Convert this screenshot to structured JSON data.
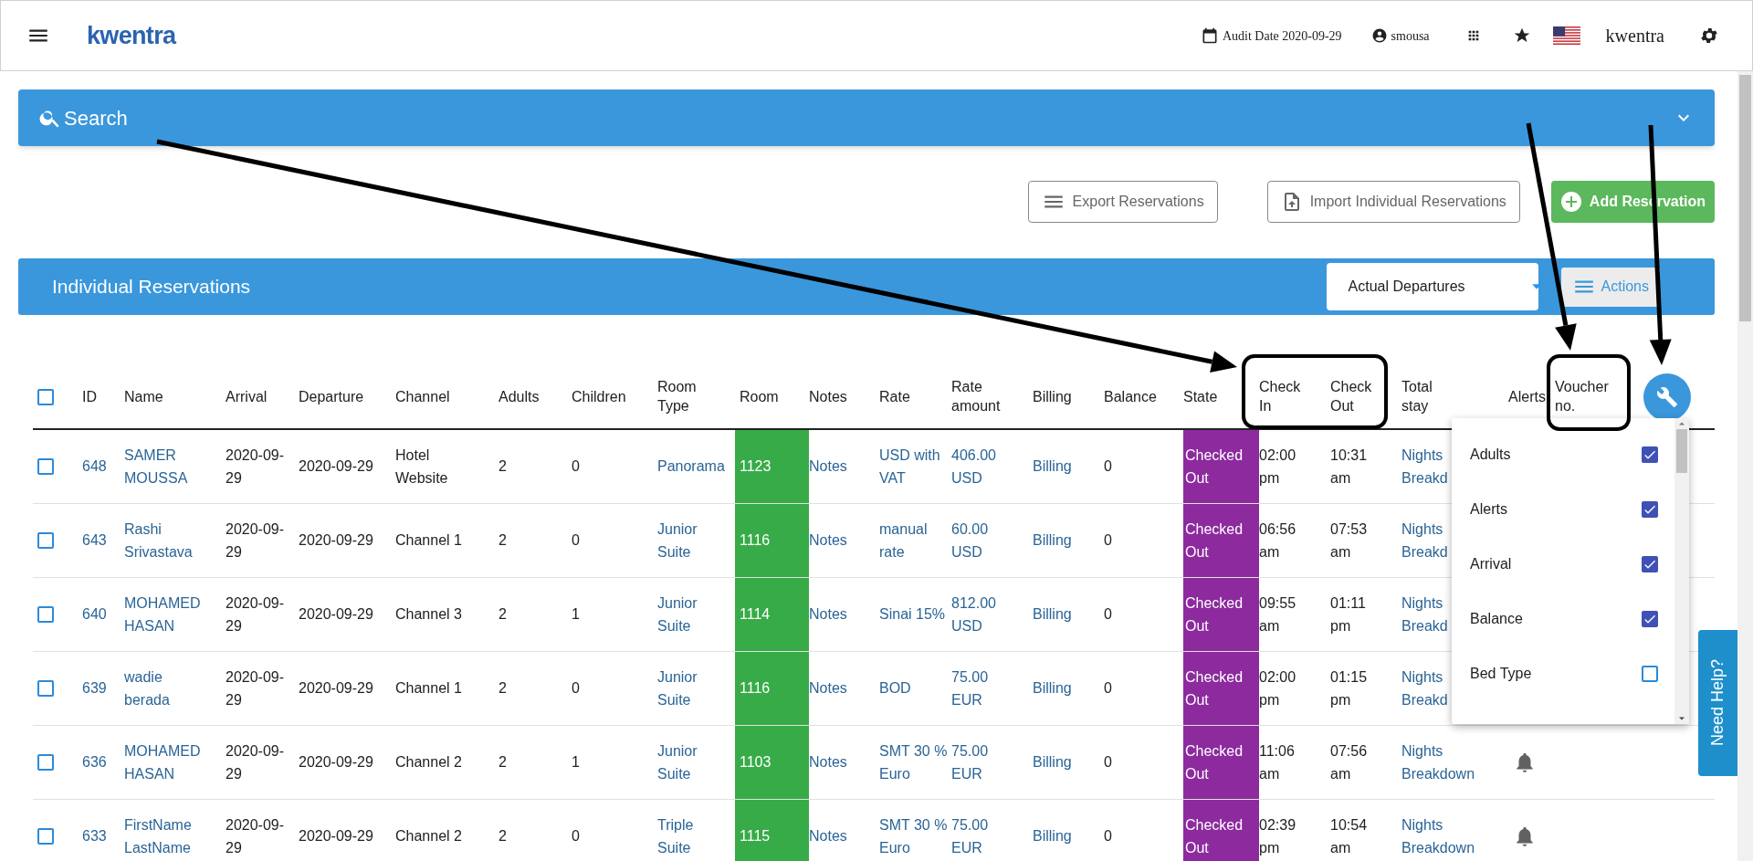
{
  "header": {
    "logo": "kwentra",
    "audit_date": "Audit Date 2020-09-29",
    "user": "smousa",
    "brand": "kwentra"
  },
  "search": {
    "label": "Search"
  },
  "buttons": [
    {
      "label": "Export Reservations",
      "kind": "export"
    },
    {
      "label": "Import Individual Reservations",
      "kind": "import"
    },
    {
      "label": "Add Reservation",
      "kind": "add"
    }
  ],
  "section": {
    "title": "Individual Reservations",
    "filter": "Actual Departures",
    "actions": "Actions"
  },
  "table": {
    "select_all": false,
    "columns": [
      "ID",
      "Name",
      "Arrival",
      "Departure",
      "Channel",
      "Adults",
      "Children",
      "Room Type",
      "Room",
      "Notes",
      "Rate",
      "Rate amount",
      "Billing",
      "Balance",
      "State",
      "Check In",
      "Check Out",
      "Total stay",
      "Alerts",
      "Voucher no."
    ],
    "rows": [
      {
        "id": "648",
        "name": "SAMER MOUSSA",
        "arrival": "2020-09-29",
        "departure": "2020-09-29",
        "channel": "Hotel Website",
        "adults": "2",
        "children": "0",
        "room_type": "Panorama",
        "room": "1123",
        "notes": "Notes",
        "rate": "USD with VAT",
        "rate_amount": "406.00 USD",
        "billing": "Billing",
        "balance": "0",
        "state": "Checked Out",
        "check_in": "02:00 pm",
        "check_out": "10:31 am",
        "total_stay": "Nights Breakd",
        "checked": false
      },
      {
        "id": "643",
        "name": "Rashi Srivastava",
        "arrival": "2020-09-29",
        "departure": "2020-09-29",
        "channel": "Channel 1",
        "adults": "2",
        "children": "0",
        "room_type": "Junior Suite",
        "room": "1116",
        "notes": "Notes",
        "rate": "manual rate",
        "rate_amount": "60.00 USD",
        "billing": "Billing",
        "balance": "0",
        "state": "Checked Out",
        "check_in": "06:56 am",
        "check_out": "07:53 am",
        "total_stay": "Nights Breakd",
        "checked": false
      },
      {
        "id": "640",
        "name": "MOHAMED HASAN",
        "arrival": "2020-09-29",
        "departure": "2020-09-29",
        "channel": "Channel 3",
        "adults": "2",
        "children": "1",
        "room_type": "Junior Suite",
        "room": "1114",
        "notes": "Notes",
        "rate": "Sinai 15%",
        "rate_amount": "812.00 USD",
        "billing": "Billing",
        "balance": "0",
        "state": "Checked Out",
        "check_in": "09:55 am",
        "check_out": "01:11 pm",
        "total_stay": "Nights Breakd",
        "checked": false
      },
      {
        "id": "639",
        "name": "wadie berada",
        "arrival": "2020-09-29",
        "departure": "2020-09-29",
        "channel": "Channel 1",
        "adults": "2",
        "children": "0",
        "room_type": "Junior Suite",
        "room": "1116",
        "notes": "Notes",
        "rate": "BOD",
        "rate_amount": "75.00 EUR",
        "billing": "Billing",
        "balance": "0",
        "state": "Checked Out",
        "check_in": "02:00 pm",
        "check_out": "01:15 pm",
        "total_stay": "Nights Breakd",
        "checked": false
      },
      {
        "id": "636",
        "name": "MOHAMED HASAN",
        "arrival": "2020-09-29",
        "departure": "2020-09-29",
        "channel": "Channel 2",
        "adults": "2",
        "children": "1",
        "room_type": "Junior Suite",
        "room": "1103",
        "notes": "Notes",
        "rate": "SMT 30 % Euro",
        "rate_amount": "75.00 EUR",
        "billing": "Billing",
        "balance": "0",
        "state": "Checked Out",
        "check_in": "11:06 am",
        "check_out": "07:56 am",
        "total_stay": "Nights Breakdown",
        "alert": true,
        "checked": false
      },
      {
        "id": "633",
        "name": "FirstName LastName",
        "arrival": "2020-09-29",
        "departure": "2020-09-29",
        "channel": "Channel 2",
        "adults": "2",
        "children": "0",
        "room_type": "Triple Suite",
        "room": "1115",
        "notes": "Notes",
        "rate": "SMT 30 % Euro",
        "rate_amount": "75.00 EUR",
        "billing": "Billing",
        "balance": "0",
        "state": "Checked Out",
        "check_in": "02:39 pm",
        "check_out": "10:54 am",
        "total_stay": "Nights Breakdown",
        "alert": true,
        "checked": false
      }
    ]
  },
  "column_menu": [
    {
      "label": "Adults",
      "checked": true
    },
    {
      "label": "Alerts",
      "checked": true
    },
    {
      "label": "Arrival",
      "checked": true
    },
    {
      "label": "Balance",
      "checked": true
    },
    {
      "label": "Bed Type",
      "checked": false
    }
  ],
  "help_tab": "Need Help?"
}
